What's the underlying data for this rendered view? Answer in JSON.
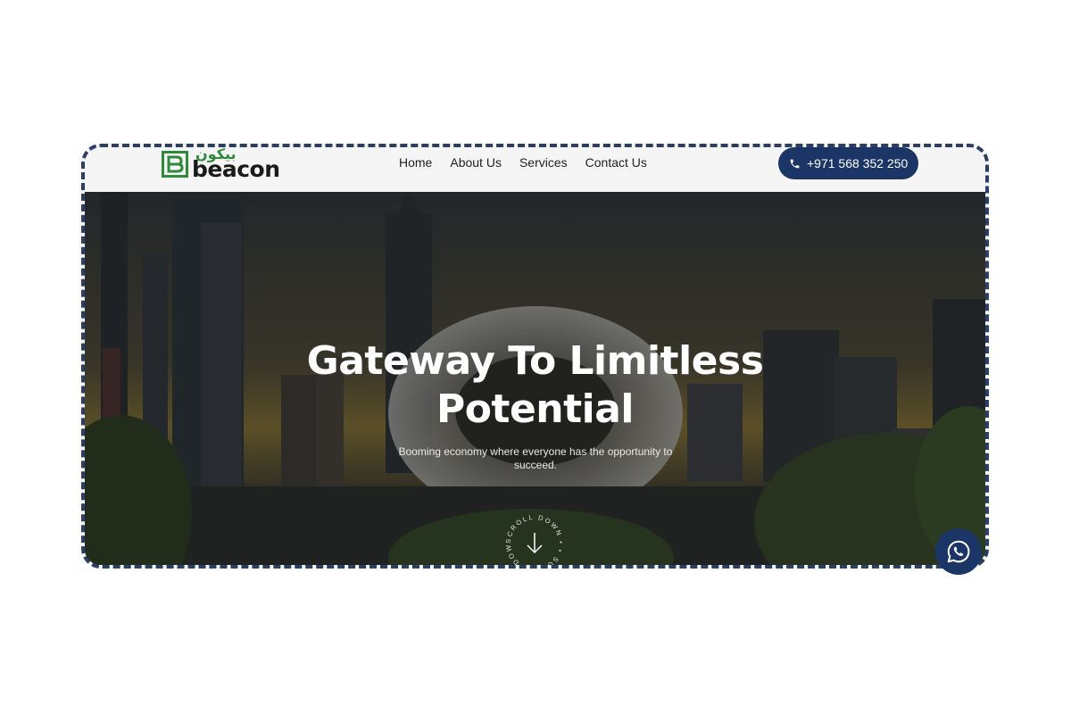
{
  "brand": {
    "name": "beacon",
    "arabic_name": "بيكون",
    "green": "#2f8a3a"
  },
  "nav": {
    "items": [
      {
        "label": "Home"
      },
      {
        "label": "About Us"
      },
      {
        "label": "Services"
      },
      {
        "label": "Contact Us"
      }
    ],
    "phone_label": "+971 568 352 250",
    "accent": "#1b3566"
  },
  "hero": {
    "title_line1": "Gateway To Limitless",
    "title_line2": "Potential",
    "subtitle": "Booming economy where everyone has the opportunity to succeed.",
    "scroll_label": "SCROLL DOWN • • SCROLL DOWN • •"
  },
  "icons": {
    "phone": "phone-icon",
    "scroll": "arrow-down-icon",
    "chat": "whatsapp-icon"
  }
}
